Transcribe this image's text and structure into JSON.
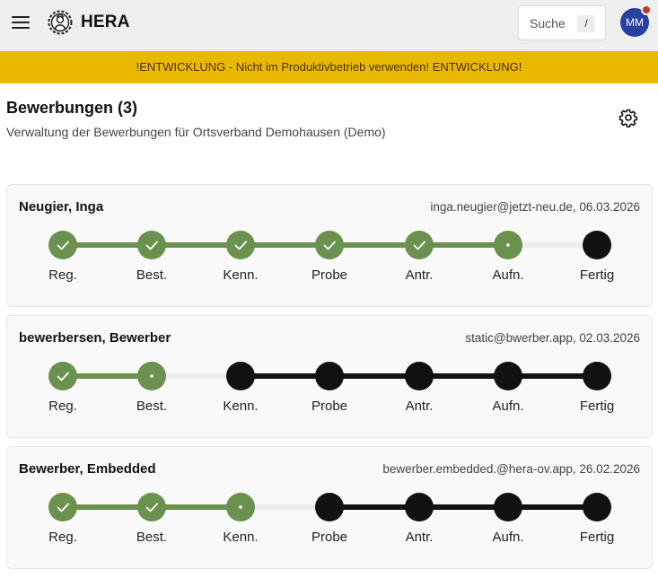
{
  "header": {
    "app_title": "HERA",
    "menu_icon": "hamburger-menu-icon",
    "logo_icon": "hera-emblem-icon",
    "search_label": "Suche",
    "search_shortcut": "/",
    "avatar_initials": "MM",
    "notification_color": "#c0392b"
  },
  "banner": {
    "text": "!ENTWICKLUNG - Nicht im Produktivbetrieb verwenden! ENTWICKLUNG!",
    "color": "#eab800"
  },
  "page": {
    "title": "Bewerbungen (3)",
    "subtitle": "Verwaltung der Bewerbungen für Ortsverband Demohausen (Demo)",
    "settings_icon": "gear-icon"
  },
  "colors": {
    "done": "#6a914e",
    "pending": "#111111",
    "connector_inactive": "#ececec"
  },
  "step_labels": [
    "Reg.",
    "Best.",
    "Kenn.",
    "Probe",
    "Antr.",
    "Aufn.",
    "Fertig"
  ],
  "applications": [
    {
      "name": "Neugier, Inga",
      "meta": "inga.neugier@jetzt-neu.de, 06.03.2026",
      "completed_steps": 5
    },
    {
      "name": "bewerbersen, Bewerber",
      "meta": "static@bwerber.app, 02.03.2026",
      "completed_steps": 1
    },
    {
      "name": "Bewerber, Embedded",
      "meta": "bewerber.embedded.@hera-ov.app, 26.02.2026",
      "completed_steps": 2
    }
  ]
}
